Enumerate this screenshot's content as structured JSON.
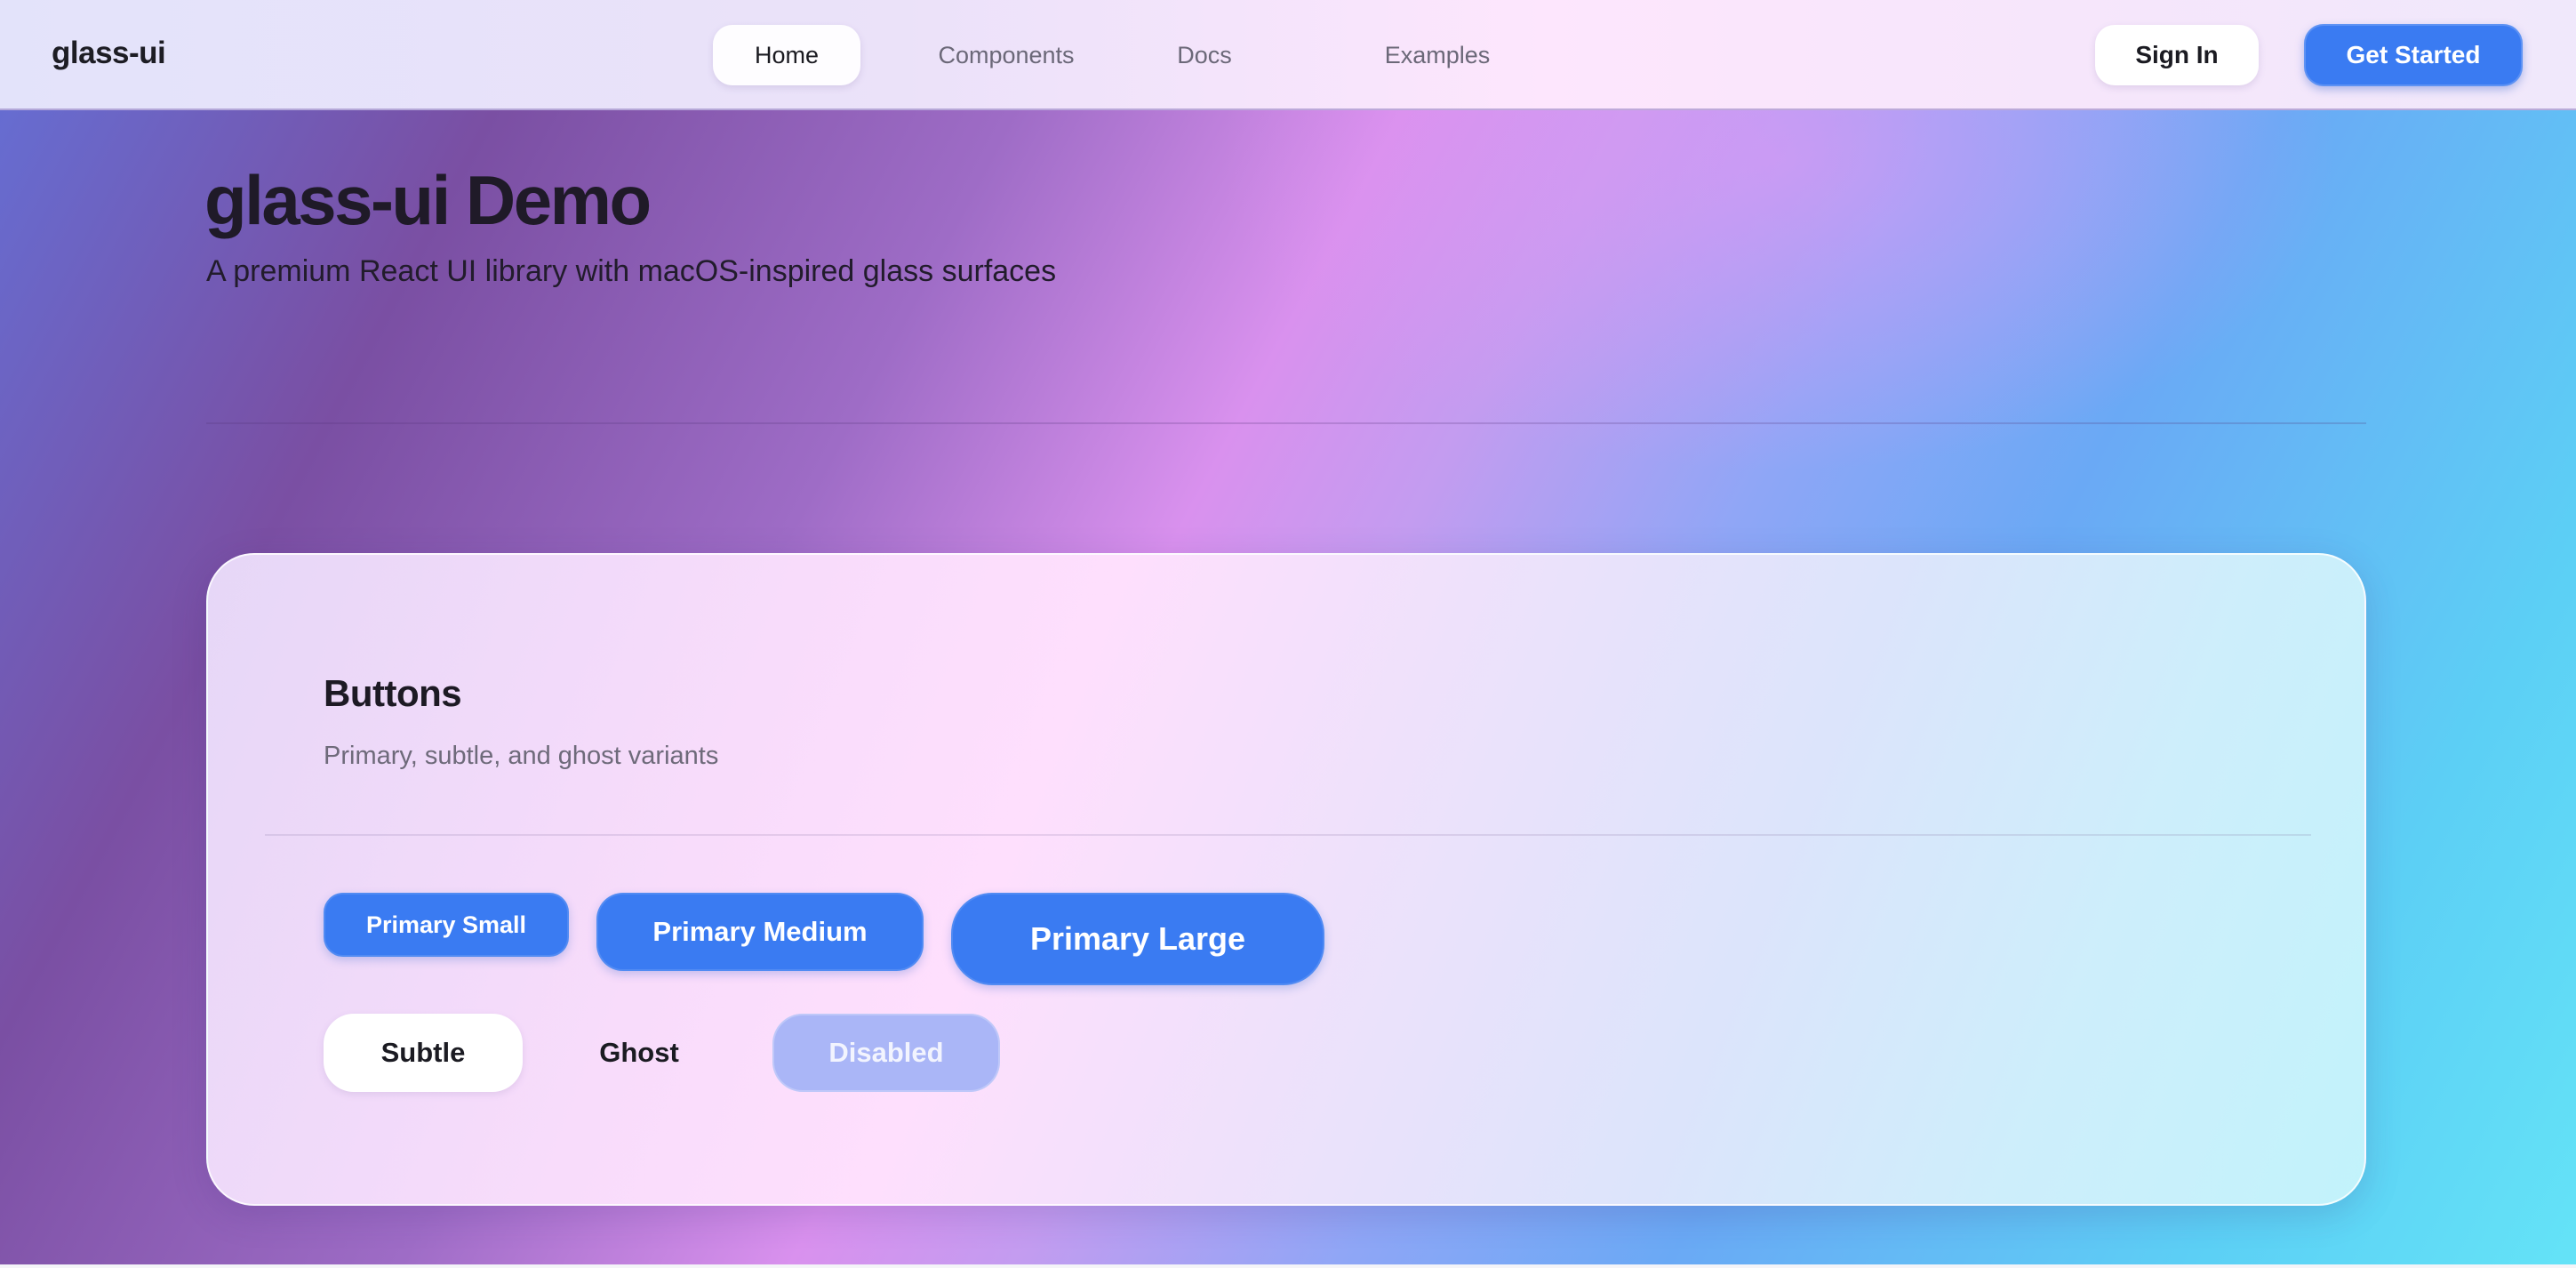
{
  "navbar": {
    "brand": "glass-ui",
    "tabs": [
      {
        "label": "Home",
        "active": true
      },
      {
        "label": "Components",
        "active": false
      },
      {
        "label": "Docs",
        "active": false
      },
      {
        "label": "Examples",
        "active": false
      }
    ],
    "sign_in_label": "Sign In",
    "get_started_label": "Get Started"
  },
  "hero": {
    "title": "glass-ui Demo",
    "subtitle": "A premium React UI library with macOS-inspired glass surfaces"
  },
  "buttons_card": {
    "title": "Buttons",
    "description": "Primary, subtle, and ghost variants",
    "primary_small_label": "Primary Small",
    "primary_medium_label": "Primary Medium",
    "primary_large_label": "Primary Large",
    "subtle_label": "Subtle",
    "ghost_label": "Ghost",
    "disabled_label": "Disabled"
  },
  "colors": {
    "accent": "#3a7bf2",
    "disabled": "#aab6f7",
    "text_primary": "#1d1a24",
    "text_muted": "#6e6a7a"
  }
}
